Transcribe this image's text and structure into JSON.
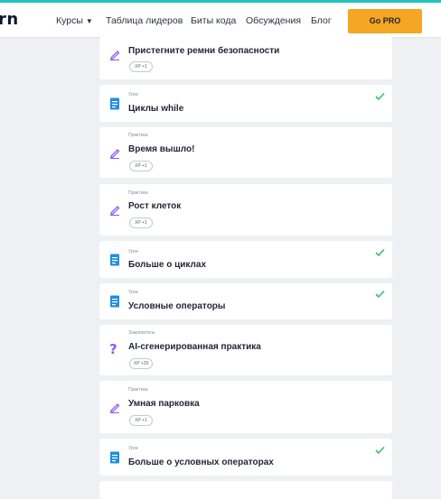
{
  "header": {
    "logo": "rn",
    "nav": {
      "courses": "Курсы",
      "leaderboard": "Таблица лидеров",
      "code_bits": "Биты кода",
      "discussions": "Обсуждения",
      "blog": "Блог"
    },
    "gopro": "Go PRO"
  },
  "colors": {
    "accent_bar": "#23c4bd",
    "gopro": "#f5a623",
    "lesson_icon": "#1e8fe0",
    "practice_icon": "#8a5cf6",
    "check": "#3dbe6d"
  },
  "items": [
    {
      "type": "",
      "title": "Пристегните ремни безопасности",
      "xp": "XP +1",
      "icon": "practice-pencil-icon",
      "completed": false
    },
    {
      "type": "Урок",
      "title": "Циклы while",
      "xp": "",
      "icon": "lesson-document-icon",
      "completed": true
    },
    {
      "type": "Практика",
      "title": "Время вышло!",
      "xp": "XP +1",
      "icon": "practice-pencil-icon",
      "completed": false
    },
    {
      "type": "Практика",
      "title": "Рост клеток",
      "xp": "XP +1",
      "icon": "practice-pencil-icon",
      "completed": false
    },
    {
      "type": "Урок",
      "title": "Больше о циклах",
      "xp": "",
      "icon": "lesson-document-icon",
      "completed": true
    },
    {
      "type": "Урок",
      "title": "Условные операторы",
      "xp": "",
      "icon": "lesson-document-icon",
      "completed": true
    },
    {
      "type": "Закрепитель",
      "title": "AI-сгенерированная практика",
      "xp": "XP +20",
      "icon": "question-mark-icon",
      "completed": false
    },
    {
      "type": "Практика",
      "title": "Умная парковка",
      "xp": "XP +1",
      "icon": "practice-pencil-icon",
      "completed": false
    },
    {
      "type": "Урок",
      "title": "Больше о условных операторах",
      "xp": "",
      "icon": "lesson-document-icon",
      "completed": true
    }
  ]
}
